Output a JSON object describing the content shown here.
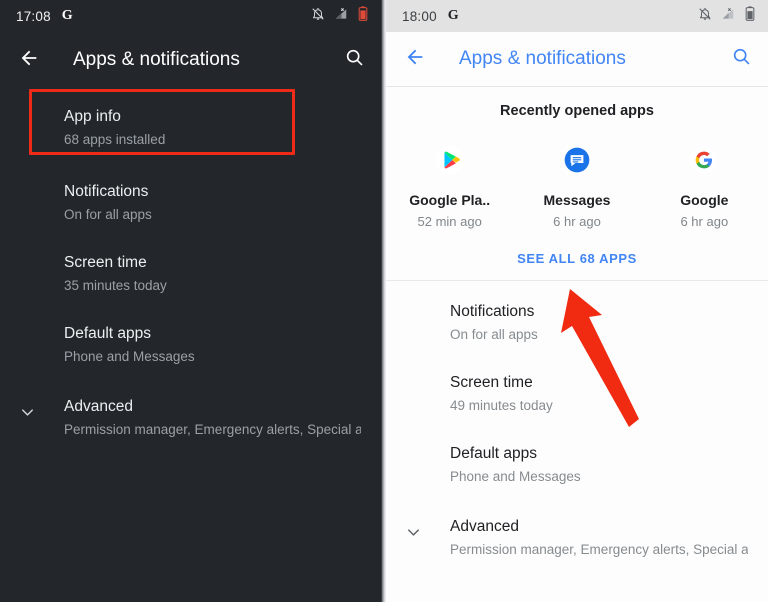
{
  "left_screen": {
    "theme": "dark",
    "status_bar": {
      "time": "17:08",
      "brand": "G",
      "icons": [
        "bell-muted-icon",
        "signal-no-sim-icon",
        "battery-icon"
      ]
    },
    "app_bar": {
      "back_label": "back-arrow",
      "title": "Apps & notifications",
      "search_label": "search"
    },
    "rows": [
      {
        "title": "App info",
        "subtitle": "68 apps installed",
        "chevron": false,
        "highlighted": true
      },
      {
        "title": "Notifications",
        "subtitle": "On for all apps",
        "chevron": false,
        "highlighted": false
      },
      {
        "title": "Screen time",
        "subtitle": "35 minutes today",
        "chevron": false,
        "highlighted": false
      },
      {
        "title": "Default apps",
        "subtitle": "Phone and Messages",
        "chevron": false,
        "highlighted": false
      },
      {
        "title": "Advanced",
        "subtitle": "Permission manager, Emergency alerts, Special ap..",
        "chevron": true,
        "highlighted": false
      }
    ]
  },
  "right_screen": {
    "theme": "light",
    "status_bar": {
      "time": "18:00",
      "brand": "G",
      "icons": [
        "bell-muted-icon",
        "signal-no-sim-icon",
        "battery-icon"
      ]
    },
    "app_bar": {
      "back_label": "back-arrow",
      "title": "Apps & notifications",
      "search_label": "search"
    },
    "recent": {
      "heading": "Recently opened apps",
      "apps": [
        {
          "name": "Google Pla..",
          "time": "52 min ago",
          "icon": "google-play-icon"
        },
        {
          "name": "Messages",
          "time": "6 hr ago",
          "icon": "messages-icon"
        },
        {
          "name": "Google",
          "time": "6 hr ago",
          "icon": "google-icon"
        }
      ],
      "see_all": "SEE ALL 68 APPS"
    },
    "rows": [
      {
        "title": "Notifications",
        "subtitle": "On for all apps",
        "chevron": false
      },
      {
        "title": "Screen time",
        "subtitle": "49 minutes today",
        "chevron": false
      },
      {
        "title": "Default apps",
        "subtitle": "Phone and Messages",
        "chevron": false
      },
      {
        "title": "Advanced",
        "subtitle": "Permission manager, Emergency alerts, Special ap..",
        "chevron": true
      }
    ]
  },
  "annotations": {
    "highlight_color": "#ee2b18",
    "arrow_color": "#f02b12",
    "arrow_target": "SEE ALL 68 APPS"
  },
  "colors": {
    "dark_bg": "#23272b",
    "light_bg": "#fdfdfd",
    "accent_blue": "#4285f4",
    "dark_status_bar": "#23272b",
    "light_status_bar": "#e2e2e2"
  }
}
